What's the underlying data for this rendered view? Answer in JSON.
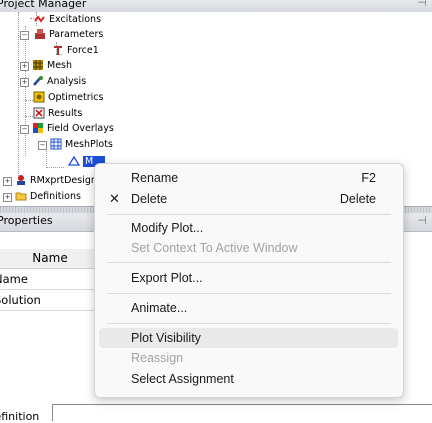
{
  "project_manager": {
    "title": "Project Manager",
    "pin_icon": "pin-icon",
    "tree": [
      {
        "label": "Excitations",
        "icon": "excitations-icon"
      },
      {
        "label": "Parameters",
        "icon": "parameters-icon"
      },
      {
        "label": "Force1",
        "icon": "force-icon"
      },
      {
        "label": "Mesh",
        "icon": "mesh-icon"
      },
      {
        "label": "Analysis",
        "icon": "analysis-icon"
      },
      {
        "label": "Optimetrics",
        "icon": "optimetrics-icon"
      },
      {
        "label": "Results",
        "icon": "results-icon"
      },
      {
        "label": "Field Overlays",
        "icon": "field-overlays-icon"
      },
      {
        "label": "MeshPlots",
        "icon": "meshplots-icon"
      },
      {
        "label": "M",
        "icon": "meshplot-item-icon"
      },
      {
        "label": "RMxprtDesign",
        "icon": "rmxprt-icon"
      },
      {
        "label": "Definitions",
        "icon": "folder-icon"
      }
    ]
  },
  "properties": {
    "title": "Properties",
    "pin_icon": "pin-icon",
    "column_header": "Name",
    "rows": [
      "Name",
      "Solution"
    ],
    "bottom_tab": "Definition"
  },
  "context_menu": {
    "items": [
      {
        "label": "Rename",
        "shortcut": "F2"
      },
      {
        "label": "Delete",
        "shortcut": "Delete",
        "icon": "close-icon"
      },
      {
        "label": "Modify Plot..."
      },
      {
        "label": "Set Context To Active Window"
      },
      {
        "label": "Export Plot..."
      },
      {
        "label": "Animate..."
      },
      {
        "label": "Plot Visibility"
      },
      {
        "label": "Reassign"
      },
      {
        "label": "Select Assignment"
      }
    ]
  }
}
